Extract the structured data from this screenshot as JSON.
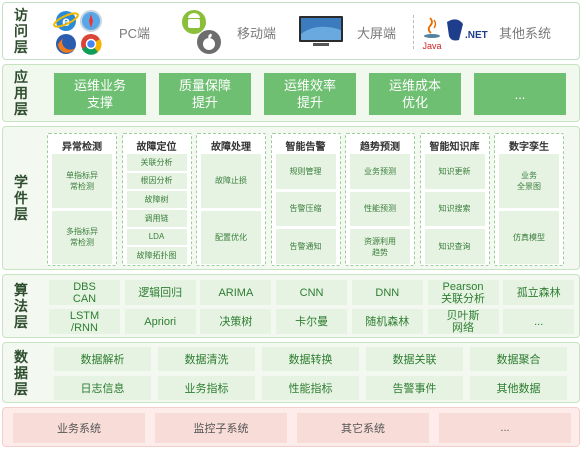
{
  "layers": {
    "access": {
      "label": [
        "访",
        "问",
        "层"
      ],
      "items": [
        "PC端",
        "移动端",
        "大屏端",
        "其他系统"
      ],
      "logos": {
        "java": "Java",
        "dotnet": ".NET"
      }
    },
    "application": {
      "label": [
        "应",
        "用",
        "层"
      ],
      "items": [
        [
          "运维业务",
          "支撑"
        ],
        [
          "质量保障",
          "提升"
        ],
        [
          "运维效率",
          "提升"
        ],
        [
          "运维成本",
          "优化"
        ],
        [
          "..."
        ]
      ]
    },
    "component": {
      "label": [
        "学",
        "件",
        "层"
      ],
      "columns": [
        {
          "title": "异常检测",
          "items": [
            [
              "单指标异",
              "常检测"
            ],
            [
              "多指标异",
              "常检测"
            ]
          ]
        },
        {
          "title": "故障定位",
          "items": [
            [
              "关联分析"
            ],
            [
              "根因分析"
            ],
            [
              "故障树"
            ],
            [
              "调用链"
            ],
            [
              "LDA"
            ],
            [
              "故障拓扑图"
            ]
          ]
        },
        {
          "title": "故障处理",
          "items": [
            [
              "故障止损"
            ],
            [
              "配置优化"
            ]
          ]
        },
        {
          "title": "智能告警",
          "items": [
            [
              "规则管理"
            ],
            [
              "告警压缩"
            ],
            [
              "告警通知"
            ]
          ]
        },
        {
          "title": "趋势预测",
          "items": [
            [
              "业务预测"
            ],
            [
              "性能预测"
            ],
            [
              "资源利用",
              "趋势"
            ]
          ]
        },
        {
          "title": "智能知识库",
          "items": [
            [
              "知识更新"
            ],
            [
              "知识搜索"
            ],
            [
              "知识查询"
            ]
          ]
        },
        {
          "title": "数字孪生",
          "items": [
            [
              "业务",
              "全景图"
            ],
            [
              "仿真模型"
            ]
          ]
        }
      ]
    },
    "algorithm": {
      "label": [
        "算",
        "法",
        "层"
      ],
      "rows": [
        [
          [
            "DBS",
            "CAN"
          ],
          [
            "逻辑回归"
          ],
          [
            "ARIMA"
          ],
          [
            "CNN"
          ],
          [
            "DNN"
          ],
          [
            "Pearson",
            "关联分析"
          ],
          [
            "孤立森林"
          ]
        ],
        [
          [
            "LSTM",
            "/RNN"
          ],
          [
            "Apriori"
          ],
          [
            "决策树"
          ],
          [
            "卡尔曼"
          ],
          [
            "随机森林"
          ],
          [
            "贝叶斯",
            "网络"
          ],
          [
            "..."
          ]
        ]
      ]
    },
    "data": {
      "label": [
        "数",
        "据",
        "层"
      ],
      "rows": [
        [
          "数据解析",
          "数据清洗",
          "数据转换",
          "数据关联",
          "数据聚合"
        ],
        [
          "日志信息",
          "业务指标",
          "性能指标",
          "告警事件",
          "其他数据"
        ]
      ]
    },
    "source": {
      "items": [
        "业务系统",
        "监控子系统",
        "其它系统",
        "..."
      ]
    }
  },
  "colors": {
    "app_box": "#6fbf73",
    "cell_bg": "#e6f3e2",
    "cell_text": "#2e7d32",
    "source_bg": "#fdecea"
  },
  "icons": [
    "ie-icon",
    "safari-icon",
    "firefox-icon",
    "chrome-icon",
    "android-icon",
    "apple-icon",
    "monitor-icon",
    "java-logo",
    "dotnet-logo"
  ]
}
